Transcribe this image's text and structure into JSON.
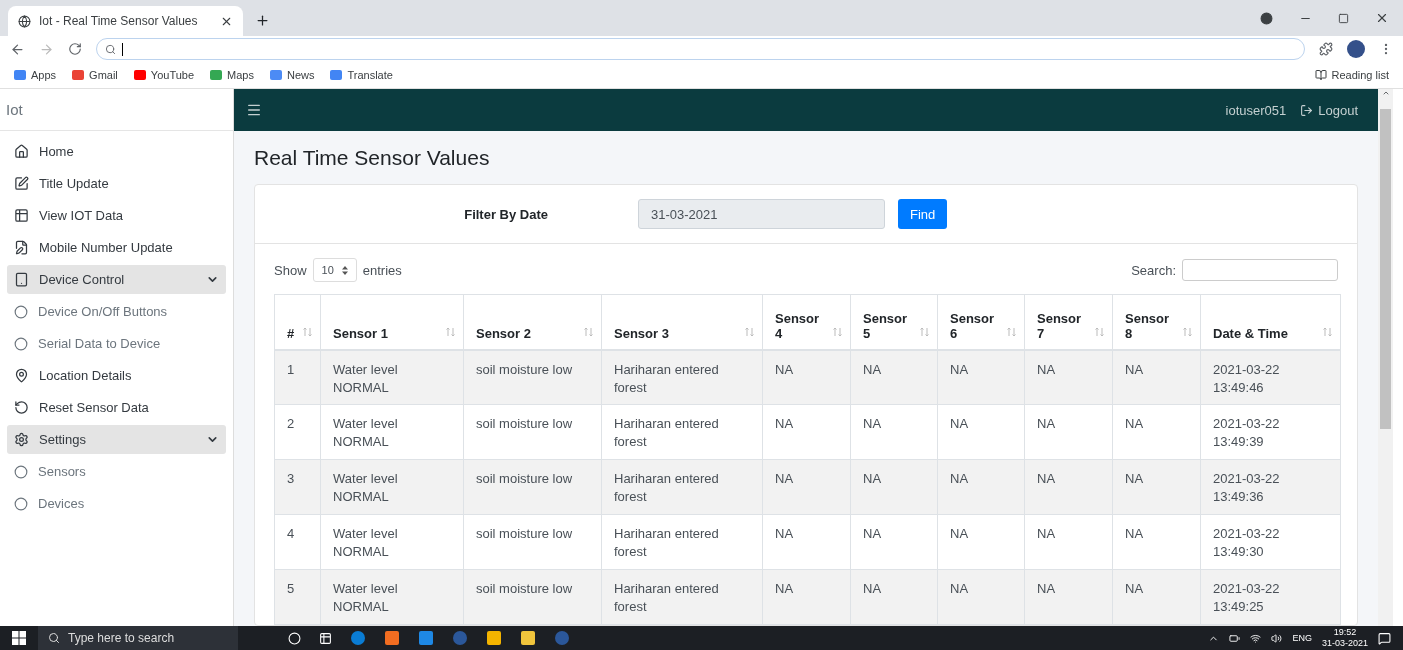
{
  "browser": {
    "tab_title": "Iot - Real Time Sensor Values",
    "bookmarks": [
      "Apps",
      "Gmail",
      "YouTube",
      "Maps",
      "News",
      "Translate"
    ],
    "reading_list": "Reading list"
  },
  "sidebar": {
    "brand": "Iot",
    "items": [
      {
        "kind": "link",
        "label": "Home"
      },
      {
        "kind": "link",
        "label": "Title Update"
      },
      {
        "kind": "link",
        "label": "View IOT Data"
      },
      {
        "kind": "link",
        "label": "Mobile Number Update"
      },
      {
        "kind": "group",
        "label": "Device Control",
        "expanded": true,
        "children": [
          {
            "label": "Device On/Off Buttons"
          },
          {
            "label": "Serial Data to Device"
          }
        ]
      },
      {
        "kind": "link",
        "label": "Location Details"
      },
      {
        "kind": "link",
        "label": "Reset Sensor Data"
      },
      {
        "kind": "group",
        "label": "Settings",
        "expanded": true,
        "children": [
          {
            "label": "Sensors"
          },
          {
            "label": "Devices"
          }
        ]
      }
    ]
  },
  "header": {
    "user": "iotuser051",
    "logout": "Logout"
  },
  "page_title": "Real Time Sensor Values",
  "filter": {
    "label": "Filter By Date",
    "value": "31-03-2021",
    "button": "Find"
  },
  "table_controls": {
    "show": "Show",
    "page_size": "10",
    "entries": "entries",
    "search": "Search:"
  },
  "table": {
    "columns": [
      "#",
      "Sensor 1",
      "Sensor 2",
      "Sensor 3",
      "Sensor 4",
      "Sensor 5",
      "Sensor 6",
      "Sensor 7",
      "Sensor 8",
      "Date & Time"
    ],
    "rows": [
      [
        "1",
        "Water level NORMAL",
        "soil moisture low",
        "Hariharan entered forest",
        "NA",
        "NA",
        "NA",
        "NA",
        "NA",
        "2021-03-22 13:49:46"
      ],
      [
        "2",
        "Water level NORMAL",
        "soil moisture low",
        "Hariharan entered forest",
        "NA",
        "NA",
        "NA",
        "NA",
        "NA",
        "2021-03-22 13:49:39"
      ],
      [
        "3",
        "Water level NORMAL",
        "soil moisture low",
        "Hariharan entered forest",
        "NA",
        "NA",
        "NA",
        "NA",
        "NA",
        "2021-03-22 13:49:36"
      ],
      [
        "4",
        "Water level NORMAL",
        "soil moisture low",
        "Hariharan entered forest",
        "NA",
        "NA",
        "NA",
        "NA",
        "NA",
        "2021-03-22 13:49:30"
      ],
      [
        "5",
        "Water level NORMAL",
        "soil moisture low",
        "Hariharan entered forest",
        "NA",
        "NA",
        "NA",
        "NA",
        "NA",
        "2021-03-22 13:49:25"
      ]
    ]
  },
  "taskbar": {
    "search_placeholder": "Type here to search",
    "language": "ENG",
    "time": "19:52",
    "date": "31-03-2021"
  }
}
